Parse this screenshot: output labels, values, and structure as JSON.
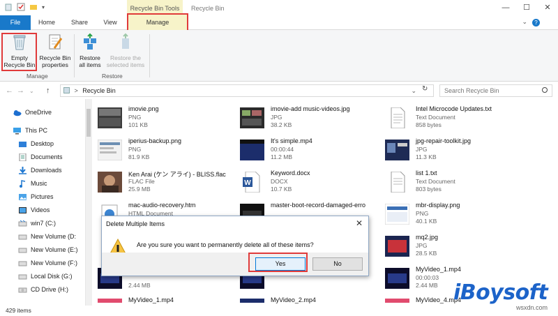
{
  "window": {
    "context_tab_group": "Recycle Bin Tools",
    "title": "Recycle Bin",
    "minimize": "—",
    "maximize": "☐",
    "close": "✕"
  },
  "tabs": [
    {
      "label": "File"
    },
    {
      "label": "Home"
    },
    {
      "label": "Share"
    },
    {
      "label": "View"
    },
    {
      "label": "Manage"
    }
  ],
  "ribbon": {
    "groups": [
      {
        "label": "Manage",
        "buttons": [
          {
            "label1": "Empty",
            "label2": "Recycle Bin",
            "icon": "empty-recycle-bin-icon"
          },
          {
            "label1": "Recycle Bin",
            "label2": "properties",
            "icon": "properties-icon"
          }
        ]
      },
      {
        "label": "Restore",
        "buttons": [
          {
            "label1": "Restore",
            "label2": "all items",
            "icon": "restore-all-icon"
          },
          {
            "label1": "Restore the",
            "label2": "selected items",
            "icon": "restore-selected-icon",
            "disabled": true
          }
        ]
      }
    ]
  },
  "address": {
    "path_separator": ">",
    "path": "Recycle Bin",
    "search_placeholder": "Search Recycle Bin"
  },
  "nav_pane": [
    {
      "label": "OneDrive",
      "icon": "cloud-icon"
    },
    {
      "label": "This PC",
      "icon": "computer-icon"
    },
    {
      "label": "Desktop",
      "icon": "folder-icon"
    },
    {
      "label": "Documents",
      "icon": "documents-icon"
    },
    {
      "label": "Downloads",
      "icon": "download-icon"
    },
    {
      "label": "Music",
      "icon": "music-icon"
    },
    {
      "label": "Pictures",
      "icon": "pictures-icon"
    },
    {
      "label": "Videos",
      "icon": "videos-icon"
    },
    {
      "label": "win7 (C:)",
      "icon": "drive-icon"
    },
    {
      "label": "New Volume (D:",
      "icon": "drive-icon"
    },
    {
      "label": "New Volume (E:)",
      "icon": "drive-icon"
    },
    {
      "label": "New Volume (F:)",
      "icon": "drive-icon"
    },
    {
      "label": "Local Disk (G:)",
      "icon": "drive-icon"
    },
    {
      "label": "CD Drive (H:)",
      "icon": "cd-drive-icon"
    }
  ],
  "files": [
    {
      "name": "imovie.png",
      "type": "PNG",
      "size": "101 KB"
    },
    {
      "name": "imovie-add music-videos.jpg",
      "type": "JPG",
      "size": "38.2 KB"
    },
    {
      "name": "Intel Microcode Updates.txt",
      "type": "Text Document",
      "size": "858 bytes"
    },
    {
      "name": "iperius-backup.png",
      "type": "PNG",
      "size": "81.9 KB"
    },
    {
      "name": "It's simple.mp4",
      "type": "00:00:44",
      "size": "11.2 MB"
    },
    {
      "name": "jpg-repair-toolkit.jpg",
      "type": "JPG",
      "size": "11.3 KB"
    },
    {
      "name": "Ken Arai (ケン アライ) - BLISS.flac",
      "type": "FLAC File",
      "size": "25.9 MB"
    },
    {
      "name": "Keyword.docx",
      "type": "DOCX",
      "size": "10.7 KB"
    },
    {
      "name": "list 1.txt",
      "type": "Text Document",
      "size": "803 bytes"
    },
    {
      "name": "mac-audio-recovery.htm",
      "type": "HTML Document",
      "size": ""
    },
    {
      "name": "master-boot-record-damaged-erro",
      "type": "",
      "size": ""
    },
    {
      "name": "mbr-display.png",
      "type": "PNG",
      "size": "40.1 KB"
    },
    {
      "name": "",
      "type": "",
      "size": ""
    },
    {
      "name": "",
      "type": "",
      "size": ""
    },
    {
      "name": "mq2.jpg",
      "type": "JPG",
      "size": "28.5 KB"
    },
    {
      "name": "",
      "type": "",
      "size": "2.44 MB"
    },
    {
      "name": "",
      "type": "",
      "size": ""
    },
    {
      "name": "MyVideo_1.mp4",
      "type": "00:00:03",
      "size": "2.44 MB"
    },
    {
      "name": "MyVideo_1.mp4",
      "type": "",
      "size": ""
    },
    {
      "name": "MyVideo_2.mp4",
      "type": "",
      "size": ""
    },
    {
      "name": "MyVideo_4.mp4",
      "type": "",
      "size": ""
    }
  ],
  "status": {
    "count": "429 items"
  },
  "dialog": {
    "title": "Delete Multiple Items",
    "message": "Are you sure you want to permanently delete all of these items?",
    "yes": "Yes",
    "no": "No"
  },
  "watermark": {
    "logo": "iBoysoft",
    "site": "wsxdn.com"
  },
  "colors": {
    "accent": "#1979ca",
    "highlight": "#e03a3a",
    "context_tab": "#f7f3c9"
  }
}
